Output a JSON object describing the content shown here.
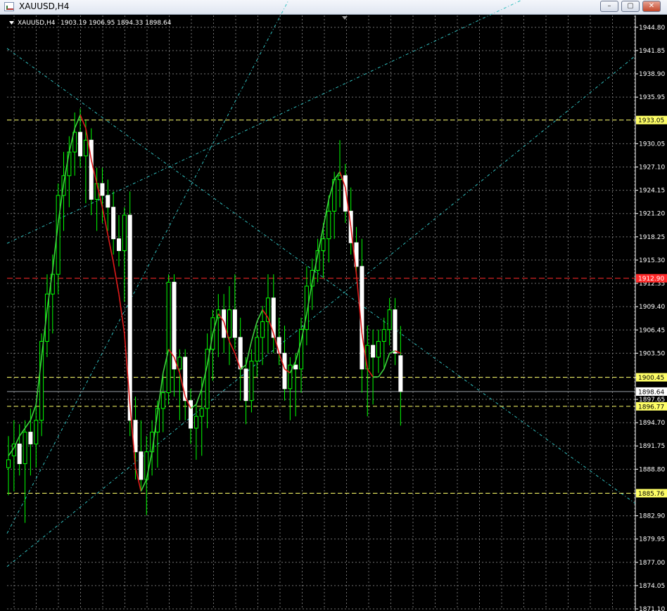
{
  "window": {
    "title": "XAUUSD,H4",
    "minimize": "–",
    "maximize": "▢",
    "close": "✕"
  },
  "chart_header": {
    "symbol": "XAUUSD,H4",
    "ohlc": "1903.19 1906.95 1894.33 1898.64"
  },
  "colors": {
    "bull": "#00ff00",
    "bear": "#ffffff",
    "ma_up": "#3fd13f",
    "ma_down": "#e01a1a",
    "grid": "#727272",
    "trend": "#31c0c0",
    "level": "#ffff66",
    "red_level": "#ff2a2a",
    "bid": "#9aa0a8",
    "axis_text": "#ffffff"
  },
  "chart_data": {
    "type": "candlestick",
    "ylim": [
      1871.1,
      1946.3
    ],
    "y_ticks": [
      "1944.80",
      "1941.85",
      "1938.90",
      "1935.95",
      "1933.05",
      "1930.05",
      "1927.10",
      "1924.15",
      "1921.20",
      "1918.25",
      "1915.30",
      "1912.35",
      "1909.40",
      "1906.45",
      "1903.50",
      "1900.45",
      "1897.65",
      "1894.70",
      "1891.75",
      "1888.80",
      "1885.76",
      "1882.90",
      "1879.95",
      "1877.00",
      "1874.05",
      "1871.10"
    ],
    "y_tick_values": [
      1944.8,
      1941.85,
      1938.9,
      1935.95,
      1933.05,
      1930.05,
      1927.1,
      1924.15,
      1921.2,
      1918.25,
      1915.3,
      1912.35,
      1909.4,
      1906.45,
      1903.5,
      1900.45,
      1897.65,
      1894.7,
      1891.75,
      1888.8,
      1885.76,
      1882.9,
      1879.95,
      1877.0,
      1874.05,
      1871.1
    ],
    "levels": [
      {
        "value": 1933.05,
        "label": "1933.05",
        "style": "yellow"
      },
      {
        "value": 1913.0,
        "label": "1912.90",
        "style": "red"
      },
      {
        "value": 1900.45,
        "label": "1900.45",
        "style": "yellow"
      },
      {
        "value": 1896.77,
        "label": "1896.77",
        "style": "yellow"
      },
      {
        "value": 1885.76,
        "label": "1885.76",
        "style": "yellow"
      }
    ],
    "bid": {
      "value": 1898.64,
      "label": "1898.64"
    },
    "candles": [
      [
        1889.0,
        1893.0,
        1885.5,
        1890.0
      ],
      [
        1890.5,
        1895.0,
        1886.0,
        1892.0
      ],
      [
        1892.0,
        1894.5,
        1888.0,
        1889.5
      ],
      [
        1889.5,
        1895.0,
        1882.0,
        1893.5
      ],
      [
        1893.5,
        1896.5,
        1888.0,
        1892.0
      ],
      [
        1892.0,
        1897.0,
        1889.0,
        1895.0
      ],
      [
        1895.0,
        1906.0,
        1893.0,
        1905.0
      ],
      [
        1905.0,
        1913.5,
        1903.0,
        1911.0
      ],
      [
        1911.0,
        1916.0,
        1906.0,
        1913.5
      ],
      [
        1913.5,
        1925.0,
        1911.0,
        1923.5
      ],
      [
        1923.5,
        1929.0,
        1919.0,
        1926.0
      ],
      [
        1926.0,
        1931.0,
        1922.0,
        1929.0
      ],
      [
        1929.0,
        1934.0,
        1926.0,
        1931.5
      ],
      [
        1931.5,
        1934.5,
        1927.0,
        1928.5
      ],
      [
        1928.5,
        1933.0,
        1922.5,
        1930.5
      ],
      [
        1930.5,
        1932.0,
        1921.0,
        1923.0
      ],
      [
        1923.0,
        1927.0,
        1919.0,
        1925.0
      ],
      [
        1925.0,
        1927.0,
        1920.0,
        1923.5
      ],
      [
        1923.5,
        1925.5,
        1919.0,
        1922.0
      ],
      [
        1922.0,
        1924.0,
        1916.0,
        1918.0
      ],
      [
        1918.0,
        1921.0,
        1914.5,
        1916.5
      ],
      [
        1916.5,
        1922.0,
        1910.0,
        1921.0
      ],
      [
        1921.0,
        1924.0,
        1893.0,
        1895.0
      ],
      [
        1895.0,
        1898.0,
        1887.5,
        1891.0
      ],
      [
        1891.0,
        1895.0,
        1886.0,
        1887.5
      ],
      [
        1887.5,
        1893.0,
        1883.0,
        1891.0
      ],
      [
        1891.0,
        1895.0,
        1888.0,
        1893.5
      ],
      [
        1893.5,
        1897.5,
        1889.0,
        1896.5
      ],
      [
        1896.5,
        1901.0,
        1893.5,
        1898.5
      ],
      [
        1898.5,
        1913.5,
        1897.0,
        1912.5
      ],
      [
        1912.5,
        1913.5,
        1898.0,
        1901.5
      ],
      [
        1901.5,
        1904.0,
        1895.0,
        1903.0
      ],
      [
        1903.0,
        1904.0,
        1895.0,
        1897.5
      ],
      [
        1897.5,
        1899.0,
        1892.0,
        1894.0
      ],
      [
        1894.0,
        1897.0,
        1890.0,
        1895.5
      ],
      [
        1895.5,
        1900.5,
        1890.5,
        1896.5
      ],
      [
        1896.5,
        1906.0,
        1894.0,
        1904.0
      ],
      [
        1904.0,
        1909.0,
        1900.0,
        1908.0
      ],
      [
        1908.0,
        1911.0,
        1903.0,
        1909.0
      ],
      [
        1909.0,
        1911.0,
        1903.5,
        1905.5
      ],
      [
        1905.5,
        1912.0,
        1902.0,
        1909.0
      ],
      [
        1909.0,
        1913.5,
        1904.0,
        1905.5
      ],
      [
        1905.5,
        1908.0,
        1897.5,
        1901.5
      ],
      [
        1901.5,
        1903.0,
        1894.5,
        1897.5
      ],
      [
        1897.5,
        1904.0,
        1896.0,
        1902.5
      ],
      [
        1902.5,
        1907.0,
        1900.5,
        1905.5
      ],
      [
        1905.5,
        1909.5,
        1902.0,
        1907.5
      ],
      [
        1907.5,
        1913.5,
        1903.5,
        1910.5
      ],
      [
        1910.5,
        1913.5,
        1903.5,
        1905.5
      ],
      [
        1905.5,
        1908.0,
        1902.0,
        1903.5
      ],
      [
        1903.5,
        1907.0,
        1897.5,
        1899.0
      ],
      [
        1899.0,
        1903.0,
        1895.0,
        1902.0
      ],
      [
        1902.0,
        1903.5,
        1895.5,
        1901.5
      ],
      [
        1901.5,
        1908.0,
        1898.5,
        1906.5
      ],
      [
        1906.5,
        1914.5,
        1904.5,
        1912.0
      ],
      [
        1912.0,
        1915.5,
        1909.0,
        1914.0
      ],
      [
        1914.0,
        1918.0,
        1912.5,
        1916.5
      ],
      [
        1916.5,
        1920.0,
        1913.0,
        1918.0
      ],
      [
        1918.0,
        1923.5,
        1915.0,
        1921.5
      ],
      [
        1921.5,
        1926.5,
        1918.0,
        1925.5
      ],
      [
        1925.5,
        1930.5,
        1922.0,
        1926.0
      ],
      [
        1926.0,
        1927.5,
        1920.0,
        1921.5
      ],
      [
        1921.5,
        1924.5,
        1916.0,
        1917.5
      ],
      [
        1917.5,
        1919.5,
        1913.0,
        1914.5
      ],
      [
        1914.5,
        1918.0,
        1898.5,
        1901.5
      ],
      [
        1901.5,
        1907.0,
        1895.5,
        1904.5
      ],
      [
        1904.5,
        1906.5,
        1897.0,
        1903.0
      ],
      [
        1903.0,
        1906.5,
        1901.0,
        1905.0
      ],
      [
        1905.0,
        1908.0,
        1901.5,
        1906.5
      ],
      [
        1906.5,
        1910.5,
        1904.5,
        1909.0
      ],
      [
        1909.0,
        1910.5,
        1902.0,
        1903.5
      ],
      [
        1903.19,
        1906.95,
        1894.33,
        1898.64
      ]
    ],
    "ma": [
      1890.5,
      1891.5,
      1893.0,
      1894.0,
      1895.0,
      1897.0,
      1903.0,
      1909.0,
      1914.0,
      1920.0,
      1925.0,
      1929.0,
      1932.0,
      1933.7,
      1932.0,
      1928.0,
      1925.0,
      1922.0,
      1918.5,
      1915.0,
      1911.0,
      1906.0,
      1897.0,
      1889.0,
      1886.0,
      1887.5,
      1891.0,
      1896.0,
      1901.0,
      1904.0,
      1903.0,
      1901.0,
      1898.0,
      1896.5,
      1897.0,
      1899.0,
      1902.0,
      1906.0,
      1908.5,
      1907.5,
      1905.0,
      1903.5,
      1901.5,
      1902.0,
      1905.0,
      1907.5,
      1909.0,
      1908.0,
      1906.0,
      1903.5,
      1901.5,
      1901.0,
      1902.5,
      1905.0,
      1908.5,
      1912.5,
      1916.0,
      1919.5,
      1923.0,
      1925.5,
      1926.5,
      1924.5,
      1919.5,
      1913.5,
      1906.0,
      1901.5,
      1900.5,
      1900.5,
      1901.5,
      1903.5,
      1903.8,
      1903.5
    ],
    "trendlines": [
      {
        "p1": [
          0,
          1876.6
        ],
        "p2": [
          71,
          1917.0
        ]
      },
      {
        "p1": [
          0,
          1881.0
        ],
        "p2": [
          43,
          1938.0
        ]
      },
      {
        "p1": [
          0,
          1942.0
        ],
        "p2": [
          71,
          1906.0
        ]
      },
      {
        "p1": [
          0,
          1917.5
        ],
        "p2": [
          71,
          1941.0
        ]
      }
    ]
  }
}
